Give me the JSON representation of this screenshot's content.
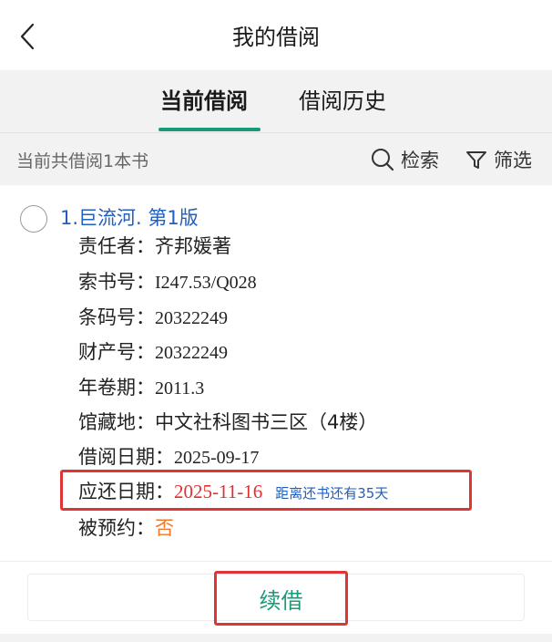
{
  "header": {
    "title": "我的借阅",
    "back_icon": "chevron-left-icon"
  },
  "tabs": [
    {
      "label": "当前借阅",
      "active": true
    },
    {
      "label": "借阅历史",
      "active": false
    }
  ],
  "toolbar": {
    "count_text": "当前共借阅1本书",
    "search_label": "检索",
    "search_icon": "search-icon",
    "filter_label": "筛选",
    "filter_icon": "filter-icon"
  },
  "book": {
    "title": "1.巨流河. 第1版",
    "fields": [
      {
        "label": "责任者：",
        "value": "齐邦媛著"
      },
      {
        "label": "索书号：",
        "value": "I247.53/Q028"
      },
      {
        "label": "条码号：",
        "value": "20322249"
      },
      {
        "label": "财产号：",
        "value": "20322249"
      },
      {
        "label": "年卷期：",
        "value": "2011.3"
      },
      {
        "label": "馆藏地：",
        "value": "中文社科图书三区（4楼）"
      },
      {
        "label": "借阅日期：",
        "value": "2025-09-17"
      }
    ],
    "due": {
      "label": "应还日期：",
      "value": "2025-11-16",
      "remaining": "距离还书还有35天"
    },
    "reserved": {
      "label": "被预约：",
      "value": "否"
    }
  },
  "actions": {
    "renew_label": "续借"
  },
  "colors": {
    "accent": "#1a9a78",
    "link": "#1f5fbf",
    "due": "#e03030",
    "reserved": "#f07828",
    "highlight": "#e03535"
  }
}
